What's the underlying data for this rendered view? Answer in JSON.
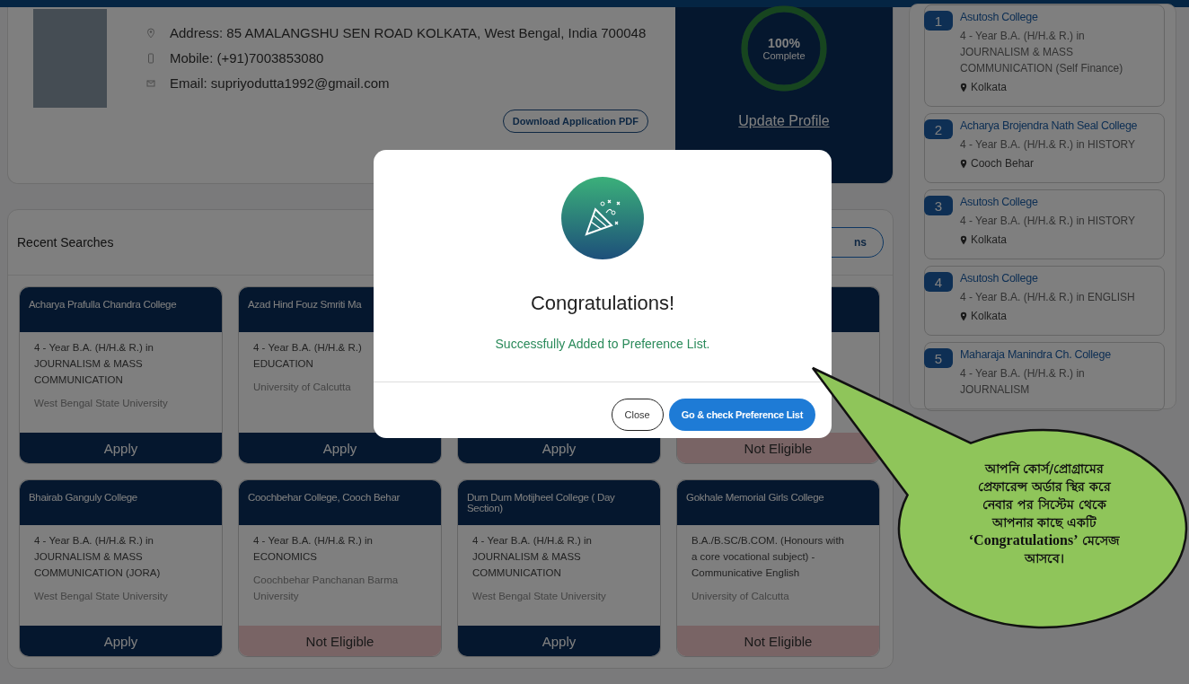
{
  "profile": {
    "address": "Address: 85 AMALANGSHU SEN ROAD KOLKATA, West Bengal, India 700048",
    "mobile": "Mobile: (+91)7003853080",
    "email": "Email: supriyodutta1992@gmail.com",
    "download_button": "Download Application PDF",
    "completion": {
      "reading": "100%",
      "caption": "Complete",
      "level": 1
    },
    "update_link": "Update Profile"
  },
  "recent_searches": {
    "title": "Recent Searches",
    "button": "ns",
    "cards": [
      {
        "college": "Acharya Prafulla Chandra College",
        "course": "4 - Year B.A. (H/H.& R.) in JOURNALISM & MASS COMMUNICATION",
        "university": "West Bengal State University",
        "action": "Apply",
        "eligible": true
      },
      {
        "college": "Azad Hind Fouz  Smriti Ma",
        "course": "4 - Year B.A. (H/H.& R.) EDUCATION",
        "university": "University of Calcutta",
        "action": "Apply",
        "eligible": true
      },
      {
        "action": "Apply",
        "eligible": true
      },
      {
        "action": "Not Eligible",
        "eligible": false
      },
      {
        "college": "Bhairab Ganguly College",
        "course": "4 - Year B.A. (H/H.& R.) in JOURNALISM & MASS COMMUNICATION (JORA)",
        "university": "West Bengal State University",
        "action": "Apply",
        "eligible": true
      },
      {
        "college": "Coochbehar College, Cooch Behar",
        "course": "4 - Year B.A. (H/H.& R.) in ECONOMICS",
        "university": "Coochbehar Panchanan Barma University",
        "action": "Not Eligible",
        "eligible": false
      },
      {
        "college": "Dum Dum Motijheel College ( Day Section)",
        "course": "4 - Year B.A. (H/H.& R.) in JOURNALISM & MASS COMMUNICATION",
        "university": "West Bengal State University",
        "action": "Apply",
        "eligible": true
      },
      {
        "college": "Gokhale Memorial Girls College",
        "course": "B.A./B.SC/B.COM. (Honours with a core vocational subject) - Communicative English",
        "university": "University of Calcutta",
        "action": "Not Eligible",
        "eligible": false
      }
    ]
  },
  "preference_list": [
    {
      "number": "1",
      "college": "Asutosh College",
      "course": "4 - Year B.A. (H/H.& R.) in JOURNALISM & MASS COMMUNICATION (Self Finance)",
      "location": "Kolkata"
    },
    {
      "number": "2",
      "college": "Acharya Brojendra Nath Seal College",
      "course": "4 - Year B.A. (H/H.& R.) in HISTORY",
      "location": "Cooch Behar"
    },
    {
      "number": "3",
      "college": "Asutosh College",
      "course": "4 - Year B.A. (H/H.& R.) in HISTORY",
      "location": "Kolkata"
    },
    {
      "number": "4",
      "college": "Asutosh College",
      "course": "4 - Year B.A. (H/H.& R.) in ENGLISH",
      "location": "Kolkata"
    },
    {
      "number": "5",
      "college": "Maharaja Manindra Ch. College",
      "course": "4 - Year B.A. (H/H.& R.) in JOURNALISM"
    }
  ],
  "modal": {
    "title": "Congratulations!",
    "message": "Successfully Added to Preference List.",
    "buttons": [
      {
        "label": "Close",
        "kind": "outline"
      },
      {
        "label": "Go & check Preference List",
        "kind": "primary"
      }
    ]
  },
  "callout": {
    "text": "আপনি কোর্স/প্রোগ্রামের প্রেফারেন্স অর্ডার স্থির করে নেবার পর সিস্টেম থেকে আপনার কাছে একটি **‘Congratulations’** মেসেজ আসবে।"
  }
}
